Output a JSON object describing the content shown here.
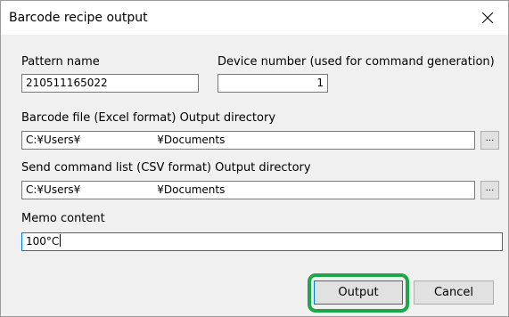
{
  "dialog": {
    "title": "Barcode recipe output",
    "close_icon": "close-icon"
  },
  "pattern": {
    "label": "Pattern name",
    "value": "210511165022"
  },
  "device": {
    "label": "Device number (used for command generation)",
    "value": "1"
  },
  "barcode_dir": {
    "label": "Barcode file (Excel format) Output directory",
    "value_prefix": "C:¥Users¥",
    "value_suffix": "¥Documents",
    "browse_label": "..."
  },
  "command_dir": {
    "label": "Send command list (CSV format) Output directory",
    "value_prefix": "C:¥Users¥",
    "value_suffix": "¥Documents",
    "browse_label": "..."
  },
  "memo": {
    "label": "Memo content",
    "value": "100°C"
  },
  "buttons": {
    "output": "Output",
    "cancel": "Cancel"
  },
  "colors": {
    "highlight": "#1fa64a",
    "focus": "#0078d7"
  }
}
